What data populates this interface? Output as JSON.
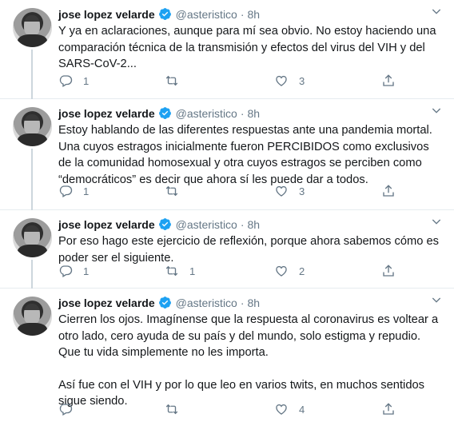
{
  "tweets": [
    {
      "name": "jose lopez velarde",
      "handle": "@asteristico",
      "separator": "·",
      "time": "8h",
      "paragraphs": [
        "Y ya en aclaraciones, aunque para mí sea obvio. No estoy haciendo una comparación técnica de la transmisión y efectos del virus del VIH y del SARS-CoV-2..."
      ],
      "replies": "1",
      "retweets": "",
      "likes": "3"
    },
    {
      "name": "jose lopez velarde",
      "handle": "@asteristico",
      "separator": "·",
      "time": "8h",
      "paragraphs": [
        "Estoy hablando de las diferentes respuestas ante una pandemia mortal.\nUna cuyos estragos inicialmente fueron PERCIBIDOS como exclusivos de la comunidad homosexual y otra cuyos estragos se perciben como “democráticos” es decir que ahora sí les puede dar a todos."
      ],
      "replies": "1",
      "retweets": "",
      "likes": "3"
    },
    {
      "name": "jose lopez velarde",
      "handle": "@asteristico",
      "separator": "·",
      "time": "8h",
      "paragraphs": [
        "Por eso hago este ejercicio de reflexión, porque ahora sabemos cómo es poder ser el siguiente."
      ],
      "replies": "1",
      "retweets": "1",
      "likes": "2"
    },
    {
      "name": "jose lopez velarde",
      "handle": "@asteristico",
      "separator": "·",
      "time": "8h",
      "paragraphs": [
        "Cierren los ojos. Imagínense que  la respuesta al coronavirus es voltear a otro lado, cero ayuda de su país y del mundo, solo estigma y repudio. Que tu vida simplemente no les importa.",
        "Así fue con el VIH y por lo que leo en varios twits, en muchos sentidos sigue siendo."
      ],
      "replies": "",
      "retweets": "",
      "likes": "4"
    }
  ],
  "colors": {
    "verified": "#1da1f2",
    "secondary": "#657786",
    "text": "#14171a",
    "thread": "#ccd6dd"
  },
  "icons": {
    "verified": "verified-badge-icon",
    "reply": "reply-icon",
    "retweet": "retweet-icon",
    "like": "heart-icon",
    "share": "share-icon",
    "caret": "chevron-down-icon"
  }
}
